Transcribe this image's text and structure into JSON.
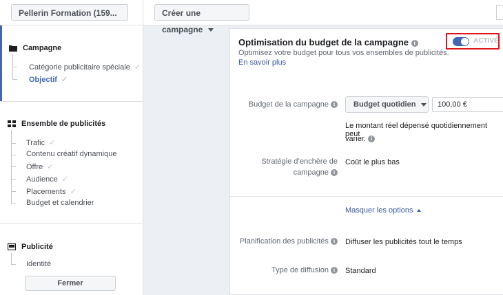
{
  "topbar": {
    "account_label": "Pellerin Formation (159...",
    "create_campaign_label": "Créer une campagne"
  },
  "sidebar": {
    "campaign": {
      "title": "Campagne",
      "items": [
        {
          "label": "Catégorie publicitaire spéciale",
          "done": true
        },
        {
          "label": "Objectif",
          "done": true,
          "active": true
        }
      ]
    },
    "adset": {
      "title": "Ensemble de publicités",
      "items": [
        {
          "label": "Trafic",
          "done": true
        },
        {
          "label": "Contenu créatif dynamique",
          "done": false
        },
        {
          "label": "Offre",
          "done": true
        },
        {
          "label": "Audience",
          "done": true
        },
        {
          "label": "Placements",
          "done": true
        },
        {
          "label": "Budget et calendrier",
          "done": false
        }
      ]
    },
    "ad": {
      "title": "Publicité",
      "items": [
        {
          "label": "Identité",
          "done": false
        }
      ]
    },
    "close_label": "Fermer"
  },
  "cbo": {
    "title": "Optimisation du budget de la campagne",
    "subtitle": "Optimisez votre budget pour tous vos ensembles de publicités.",
    "learn_more": "En savoir plus",
    "toggle_label": "ACTIVÉ",
    "toggle_on": true,
    "budget_label": "Budget de la campagne",
    "budget_type": "Budget quotidien",
    "budget_amount": "100,00 €",
    "budget_note_line1": "Le montant réel dépensé quotidiennement peut",
    "budget_note_line2": "varier.",
    "bid_label_line1": "Stratégie d’enchère de",
    "bid_label_line2": "campagne",
    "bid_value": "Coût le plus bas",
    "hide_options": "Masquer les options",
    "schedule_label": "Planification des publicités",
    "schedule_value": "Diffuser les publicités tout le temps",
    "delivery_label": "Type de diffusion",
    "delivery_value": "Standard"
  },
  "colors": {
    "accent": "#4267b2",
    "link": "#385898",
    "highlight_box": "#e0141a"
  }
}
